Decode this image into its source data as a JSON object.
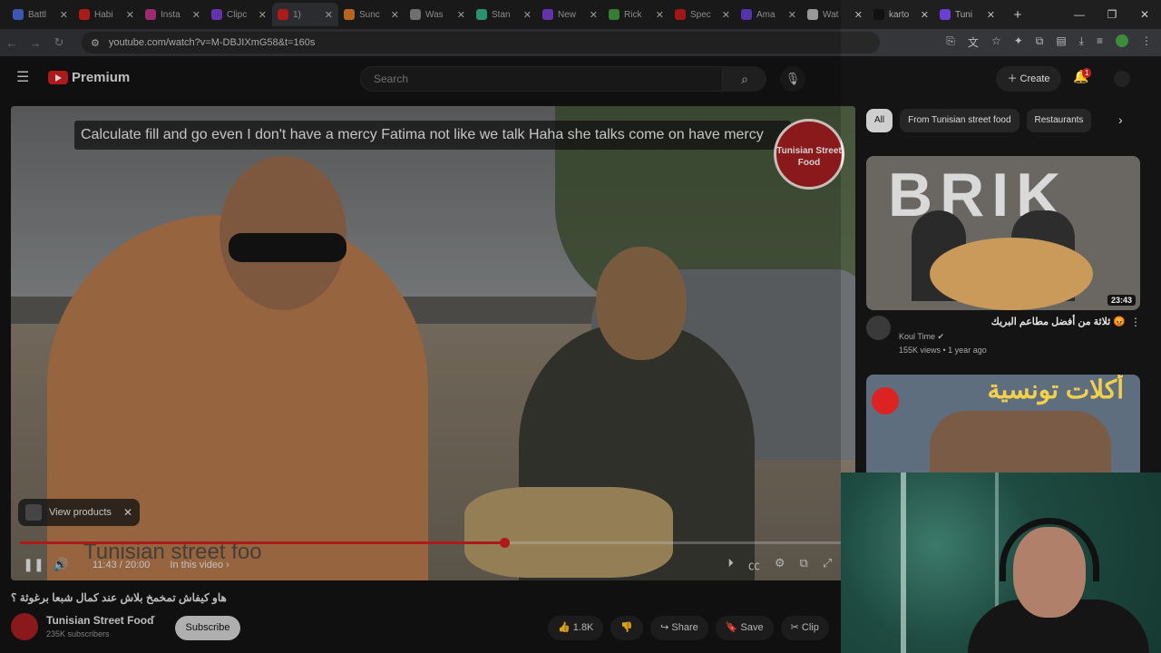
{
  "browser": {
    "tabs": [
      {
        "label": "Battl",
        "color": "#4a6bd6"
      },
      {
        "label": "Habi",
        "color": "#d42020"
      },
      {
        "label": "Insta",
        "color": "#c1358a"
      },
      {
        "label": "Clipc",
        "color": "#7b3fd1"
      },
      {
        "label": "1)",
        "color": "#d42020",
        "active": true
      },
      {
        "label": "Sunc",
        "color": "#e07a2b"
      },
      {
        "label": "Was",
        "color": "#888888"
      },
      {
        "label": "Stan",
        "color": "#33b38a"
      },
      {
        "label": "New",
        "color": "#7b3fd1"
      },
      {
        "label": "Rick",
        "color": "#3f9a3f"
      },
      {
        "label": "Spec",
        "color": "#c41d1d"
      },
      {
        "label": "Ama",
        "color": "#6a3fd1"
      },
      {
        "label": "Wat",
        "color": "#bbbbbb"
      },
      {
        "label": "karto",
        "color": "#111111"
      },
      {
        "label": "Tuni",
        "color": "#6a3fd1"
      }
    ],
    "url": "youtube.com/watch?v=M-DBJIXmG58&t=160s"
  },
  "youtube": {
    "logo_text": "Premium",
    "search_placeholder": "Search",
    "create_label": "Create",
    "notifications_count": "1"
  },
  "player": {
    "caption": "Calculate fill and go even I don't have a mercy Fatima not like we talk Haha she talks come on have mercy",
    "channel_logo_text": "Tunisian Street Food",
    "view_products_label": "View products",
    "watermark_text": "Tunisian street foo",
    "time_display": "11:43 / 20:00",
    "in_this_video_label": "In this video",
    "progress": 0.586
  },
  "video_info": {
    "title": "هاو كيفاش تمخمخ بلاش عند كمال شبعا برغوثة ؟",
    "channel_name": "Tunisian Street Food",
    "subscribers": "235K subscribers",
    "subscribe_label": "Subscribe",
    "likes": "1.8K",
    "share_label": "Share",
    "save_label": "Save",
    "clip_label": "Clip"
  },
  "sidebar": {
    "chips": [
      {
        "label": "All",
        "active": true
      },
      {
        "label": "From Tunisian street food"
      },
      {
        "label": "Restaurants"
      }
    ],
    "videos": [
      {
        "thumb_text": "BRIK",
        "duration": "23:43",
        "title": "😡 ثلاثة من أفضل مطاعم البريك",
        "channel": "Koul Time",
        "views": "155K views • 1 year ago"
      },
      {
        "thumb_text": "أكلات تونسية"
      }
    ]
  }
}
